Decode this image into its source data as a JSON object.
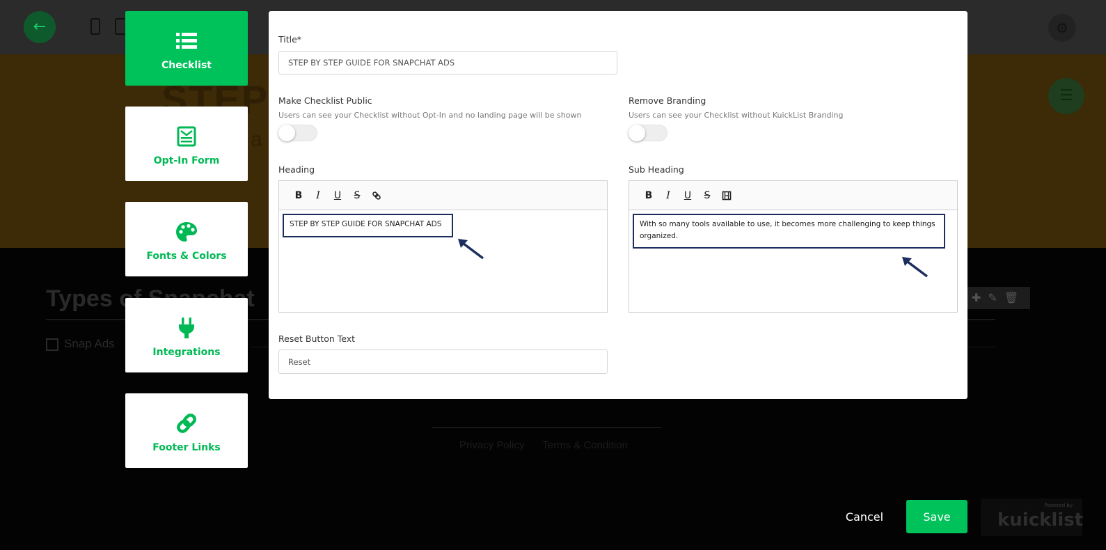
{
  "background": {
    "hero_title": "STEP",
    "hero_sub": "a",
    "section_title": "Types of Snapchat",
    "checklist_item": "Snap Ads",
    "footer_links": [
      "Privacy Policy",
      "Terms & Condition"
    ]
  },
  "tabs": [
    {
      "label": "Checklist",
      "icon": "list-icon",
      "active": true
    },
    {
      "label": "Opt-In Form",
      "icon": "form-icon",
      "active": false
    },
    {
      "label": "Fonts & Colors",
      "icon": "palette-icon",
      "active": false
    },
    {
      "label": "Integrations",
      "icon": "plug-icon",
      "active": false
    },
    {
      "label": "Footer Links",
      "icon": "link-icon",
      "active": false
    }
  ],
  "form": {
    "title_label": "Title*",
    "title_value": "STEP BY STEP GUIDE FOR SNAPCHAT ADS",
    "public_label": "Make Checklist Public",
    "public_desc": "Users can see your Checklist without Opt-In and no landing page will be shown",
    "branding_label": "Remove Branding",
    "branding_desc": "Users can see your Checklist without KuickList Branding",
    "heading_label": "Heading",
    "heading_value": "STEP BY STEP GUIDE FOR SNAPCHAT ADS",
    "subheading_label": "Sub Heading",
    "subheading_value": "With so many tools available to use, it becomes more challenging to keep things organized.",
    "reset_label": "Reset Button Text",
    "reset_value": "Reset"
  },
  "toggles": {
    "public": false,
    "remove_branding": false
  },
  "buttons": {
    "cancel": "Cancel",
    "save": "Save"
  },
  "brand": {
    "powered": "Powered by",
    "logo": "kuicklist"
  },
  "colors": {
    "accent": "#00c25a",
    "highlight_border": "#1c2e5e",
    "overlay": "#000000"
  }
}
